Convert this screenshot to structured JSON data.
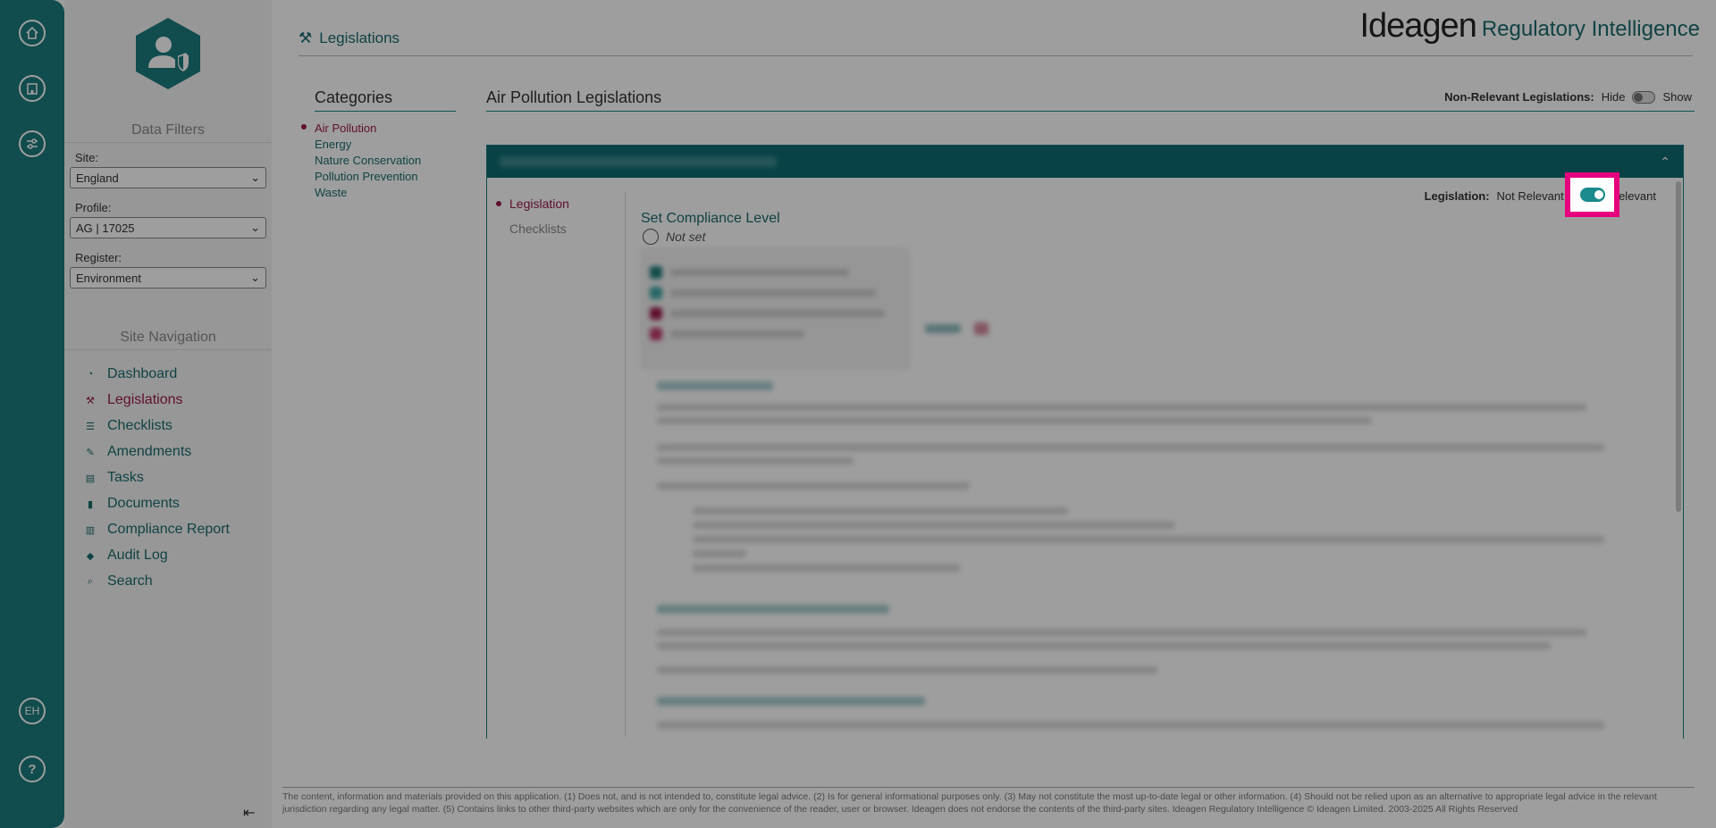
{
  "rail": {
    "user_initials": "EH",
    "help_label": "?"
  },
  "filters": {
    "section_title": "Data Filters",
    "site_label": "Site:",
    "site_value": "England",
    "profile_label": "Profile:",
    "profile_value": "AG | 17025",
    "register_label": "Register:",
    "register_value": "Environment"
  },
  "site_nav": {
    "section_title": "Site Navigation",
    "items": [
      {
        "label": "Dashboard",
        "icon": "dashboard-icon"
      },
      {
        "label": "Legislations",
        "icon": "gavel-icon"
      },
      {
        "label": "Checklists",
        "icon": "list-icon"
      },
      {
        "label": "Amendments",
        "icon": "edit-icon"
      },
      {
        "label": "Tasks",
        "icon": "tasks-icon"
      },
      {
        "label": "Documents",
        "icon": "document-icon"
      },
      {
        "label": "Compliance Report",
        "icon": "chart-icon"
      },
      {
        "label": "Audit Log",
        "icon": "tags-icon"
      },
      {
        "label": "Search",
        "icon": "search-icon"
      }
    ]
  },
  "header": {
    "page_title": "Legislations",
    "brand_name": "Ideagen",
    "brand_product": "Regulatory Intelligence"
  },
  "categories": {
    "title": "Categories",
    "items": [
      "Air Pollution",
      "Energy",
      "Nature Conservation",
      "Pollution Prevention",
      "Waste"
    ]
  },
  "legislations": {
    "title": "Air Pollution Legislations",
    "non_relevant_label": "Non-Relevant Legislations:",
    "hide_label": "Hide",
    "show_label": "Show"
  },
  "panel": {
    "sub_nav": [
      "Legislation",
      "Checklists"
    ],
    "legislation_label": "Legislation:",
    "not_relevant_label": "Not Relevant",
    "relevant_label": "Relevant",
    "compliance_title": "Set Compliance Level",
    "not_set_label": "Not set"
  },
  "footer": {
    "text": "The content, information and materials provided on this application. (1) Does not, and is not intended to, constitute legal advice. (2) Is for general informational purposes only. (3) May not constitute the most up-to-date legal or other information. (4) Should not be relied upon as an alternative to appropriate legal advice in the relevant jurisdiction regarding any legal matter. (5) Contains links to other third-party websites which are only for the convenience of the reader, user or browser. Ideagen does not endorse the contents of the third-party sites. Ideagen Regulatory Intelligence © Ideagen Limited. 2003-2025 All Rights Reserved"
  },
  "colors": {
    "teal": "#1c7b7e",
    "accent": "#9a1b4f",
    "highlight": "#e6007e"
  }
}
